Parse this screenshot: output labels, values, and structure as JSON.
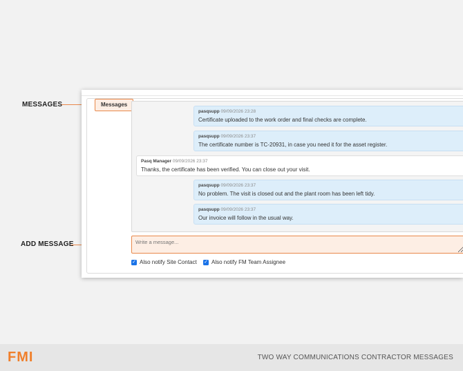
{
  "callouts": {
    "messages_label": "MESSAGES",
    "add_message_label": "ADD MESSAGE"
  },
  "panel": {
    "legend": "Messages"
  },
  "messages": [
    {
      "author": "pasqsupp",
      "timestamp": "09/09/2026 23:28",
      "text": "Certificate uploaded to the work order and final checks are complete.",
      "own": true
    },
    {
      "author": "pasqsupp",
      "timestamp": "09/09/2026 23:37",
      "text": "The certificate number is TC-20931, in case you need it for the asset register.",
      "own": true
    },
    {
      "author": "Pasq Manager",
      "timestamp": "09/09/2026 23:37",
      "text": "Thanks, the certificate has been verified. You can close out your visit.",
      "own": false
    },
    {
      "author": "pasqsupp",
      "timestamp": "09/09/2026 23:37",
      "text": "No problem. The visit is closed out and the plant room has been left tidy.",
      "own": true
    },
    {
      "author": "pasqsupp",
      "timestamp": "09/09/2026 23:37",
      "text": "Our invoice will follow in the usual way.",
      "own": true
    }
  ],
  "compose": {
    "placeholder": "Write a message..."
  },
  "notify": {
    "site_contact": {
      "label": "Also notify Site Contact",
      "checked": true
    },
    "fm_team": {
      "label": "Also notify FM Team Assignee",
      "checked": true
    }
  },
  "footer": {
    "logo": "FMI",
    "title": "TWO WAY COMMUNICATIONS CONTRACTOR MESSAGES"
  },
  "colors": {
    "accent": "#e8884a",
    "own_bubble": "#ddeefa",
    "checkbox": "#1a73e8"
  }
}
